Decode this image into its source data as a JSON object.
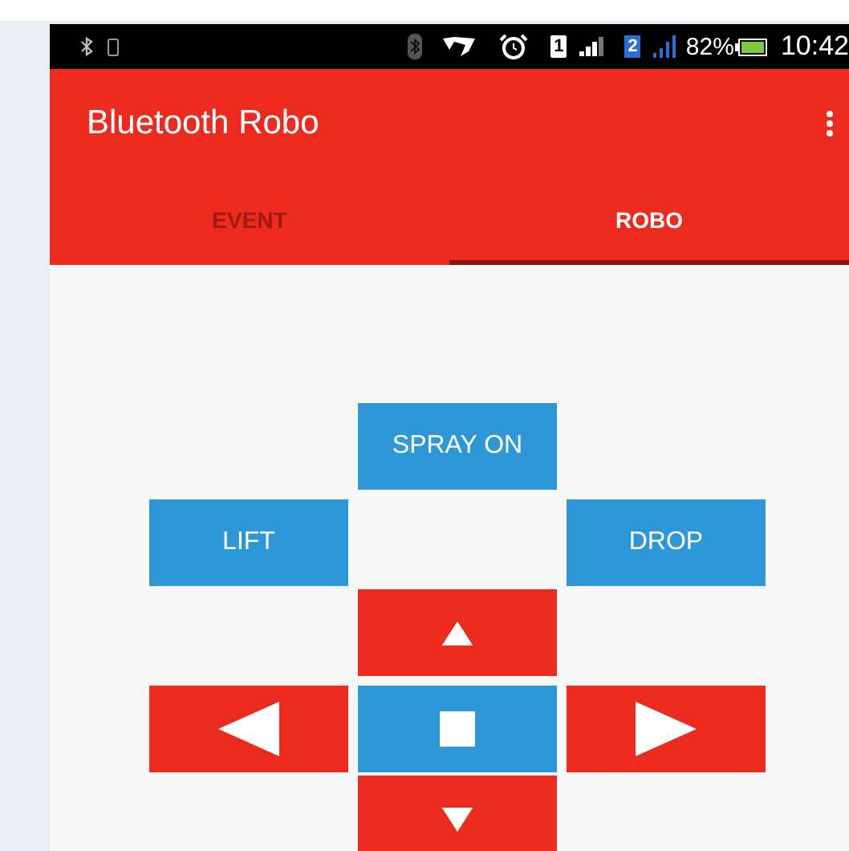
{
  "status_bar": {
    "sim_badges": [
      "1",
      "2"
    ],
    "battery": "82%",
    "time": "10:42"
  },
  "app_bar": {
    "title": "Bluetooth Robo"
  },
  "tabs": [
    {
      "label": "EVENT",
      "selected": false
    },
    {
      "label": "ROBO",
      "selected": true
    }
  ],
  "pad": [
    [
      {
        "kind": "blank"
      },
      {
        "kind": "label",
        "label": "SPRAY ON",
        "color": "#2e97d8"
      },
      {
        "kind": "blank"
      }
    ],
    [
      {
        "kind": "label",
        "label": "LIFT",
        "color": "#2e97d8"
      },
      {
        "kind": "blank"
      },
      {
        "kind": "label",
        "label": "DROP",
        "color": "#2e97d8"
      }
    ],
    [
      {
        "kind": "blank"
      },
      {
        "kind": "up",
        "color": "#ec2a1e"
      },
      {
        "kind": "blank"
      }
    ],
    [
      {
        "kind": "left",
        "color": "#ec2a1e"
      },
      {
        "kind": "stop",
        "color": "#2e97d8"
      },
      {
        "kind": "right",
        "color": "#ec2a1e"
      }
    ],
    [
      {
        "kind": "blank"
      },
      {
        "kind": "down",
        "color": "#ec2a1e"
      },
      {
        "kind": "blank"
      }
    ]
  ]
}
